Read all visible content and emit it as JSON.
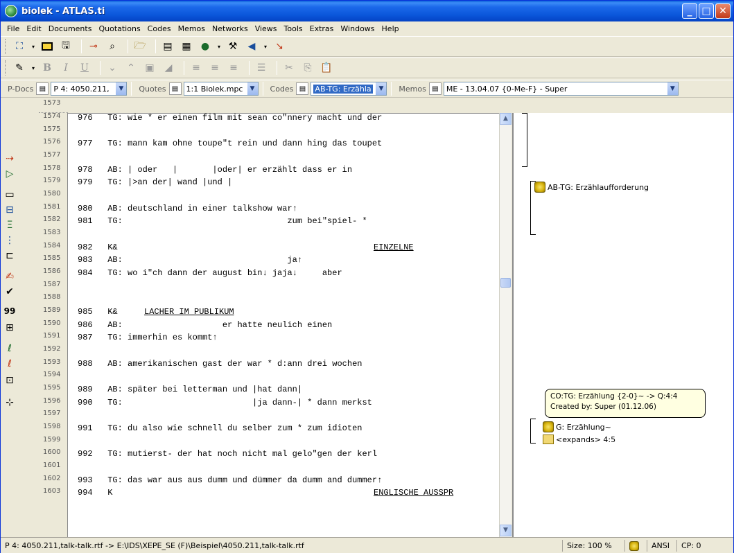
{
  "window": {
    "title": "biolek - ATLAS.ti"
  },
  "menu": [
    "File",
    "Edit",
    "Documents",
    "Quotations",
    "Codes",
    "Memos",
    "Networks",
    "Views",
    "Tools",
    "Extras",
    "Windows",
    "Help"
  ],
  "selectors": {
    "pdocs_label": "P-Docs",
    "pdocs_value": "P 4: 4050.211,",
    "quotes_label": "Quotes",
    "quotes_value": "1:1 Biolek.mpc",
    "codes_label": "Codes",
    "codes_value": "AB-TG: Erzähla",
    "memos_label": "Memos",
    "memos_value": "ME - 13.04.07 {0-Me-F} - Super"
  },
  "line_numbers": [
    "1573",
    "1574",
    "1575",
    "1576",
    "1577",
    "1578",
    "1579",
    "1580",
    "1581",
    "1582",
    "1583",
    "1584",
    "1585",
    "1586",
    "1587",
    "1588",
    "1589",
    "1590",
    "1591",
    "1592",
    "1593",
    "1594",
    "1595",
    "1596",
    "1597",
    "1598",
    "1599",
    "1600",
    "1601",
    "1602",
    "1603"
  ],
  "transcript": [
    "976   TG: wie * er einen film mit sean co\"nnery macht und der",
    "977   TG: mann kam ohne toupe\"t rein und dann hing das toupet",
    "978   AB: | oder   |       |oder| er erzählt dass er in",
    "979   TG: |>an der| wand |und |",
    "980   AB: deutschland in einer talkshow war↑",
    "981   TG:                                 zum bei\"spiel- *",
    "982   K&                                  ",
    "983   AB:                                 ja↑",
    "984   TG: wo i\"ch dann der august bin↓ jaja↓     aber",
    "985   K&  ",
    "986   AB:                    er hatte neulich einen",
    "987   TG: immerhin es kommt↑",
    "988   AB: amerikanischen gast der war * d:ann drei wochen",
    "989   AB: später bei letterman und |hat dann|",
    "990   TG:                          |ja dann-| * dann merkst",
    "991   TG: du also wie schnell du selber zum * zum idioten",
    "992   TG: mutierst- der hat noch nicht mal gelo\"gen der kerl",
    "993   TG: das war aus aus dumm und dümmer da dumm and dummer↑",
    "994   K   "
  ],
  "underlined": {
    "einzelne": "EINZELNE",
    "lacher": "LACHER IM PUBLIKUM",
    "englische": "ENGLISCHE AUSSPR"
  },
  "margin": {
    "code1": "AB-TG: Erzählaufforderung",
    "code2": "G: Erzählung~",
    "link1": "<expands> 4:5"
  },
  "tooltip": {
    "line1": "CO:TG: Erzählung {2-0}~  -> Q:4:4",
    "line2": "Created by: Super (01.12.06)"
  },
  "status": {
    "path": "P 4: 4050.211,talk-talk.rtf -> E:\\IDS\\XEPE_SE (F)\\Beispiel\\4050.211,talk-talk.rtf",
    "size": "Size: 100 %",
    "encoding": "ANSI",
    "cp": "CP: 0"
  }
}
